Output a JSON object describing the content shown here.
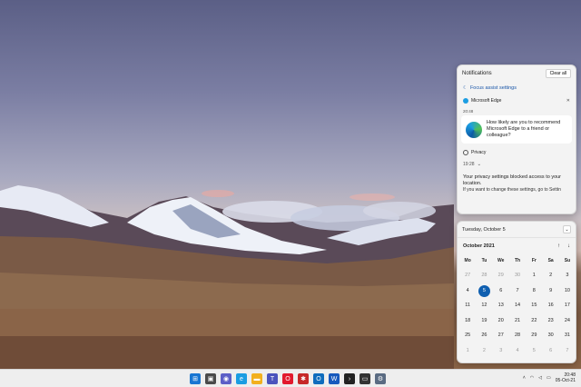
{
  "notifications": {
    "title": "Notifications",
    "clear_all": "Clear all",
    "focus_assist": "Focus assist settings",
    "edge": {
      "app_name": "Microsoft Edge",
      "time": "20:48",
      "message": "How likely are you to recommend Microsoft Edge to a friend or colleague?"
    },
    "privacy": {
      "app_name": "Privacy",
      "time": "19:28",
      "message": "Your privacy settings blocked access to your location.",
      "sub": "If you want to change these settings, go to Settin"
    }
  },
  "calendar": {
    "date_header": "Tuesday, October 5",
    "month": "October 2021",
    "prev_label": "↑",
    "next_label": "↓",
    "collapse_label": "⌄",
    "weekdays": [
      "Mo",
      "Tu",
      "We",
      "Th",
      "Fr",
      "Sa",
      "Su"
    ],
    "days": [
      {
        "d": "27",
        "m": true
      },
      {
        "d": "28",
        "m": true
      },
      {
        "d": "29",
        "m": true
      },
      {
        "d": "30",
        "m": true
      },
      {
        "d": "1"
      },
      {
        "d": "2"
      },
      {
        "d": "3"
      },
      {
        "d": "4"
      },
      {
        "d": "5",
        "today": true
      },
      {
        "d": "6"
      },
      {
        "d": "7"
      },
      {
        "d": "8"
      },
      {
        "d": "9"
      },
      {
        "d": "10"
      },
      {
        "d": "11"
      },
      {
        "d": "12"
      },
      {
        "d": "13"
      },
      {
        "d": "14"
      },
      {
        "d": "15"
      },
      {
        "d": "16"
      },
      {
        "d": "17"
      },
      {
        "d": "18"
      },
      {
        "d": "19"
      },
      {
        "d": "20"
      },
      {
        "d": "21"
      },
      {
        "d": "22"
      },
      {
        "d": "23"
      },
      {
        "d": "24"
      },
      {
        "d": "25"
      },
      {
        "d": "26"
      },
      {
        "d": "27"
      },
      {
        "d": "28"
      },
      {
        "d": "29"
      },
      {
        "d": "30"
      },
      {
        "d": "31"
      },
      {
        "d": "1",
        "m": true
      },
      {
        "d": "2",
        "m": true
      },
      {
        "d": "3",
        "m": true
      },
      {
        "d": "4",
        "m": true
      },
      {
        "d": "5",
        "m": true
      },
      {
        "d": "6",
        "m": true
      },
      {
        "d": "7",
        "m": true
      }
    ]
  },
  "taskbar": {
    "apps": [
      {
        "name": "start-icon",
        "color": "#1976d2",
        "glyph": "⊞"
      },
      {
        "name": "task-view-icon",
        "color": "#4a4a4a",
        "glyph": "▣"
      },
      {
        "name": "chat-icon",
        "color": "#5b5fc7",
        "glyph": "◉"
      },
      {
        "name": "edge-icon",
        "color": "#1b9de2",
        "glyph": "e"
      },
      {
        "name": "file-explorer-icon",
        "color": "#f2b01e",
        "glyph": "▬"
      },
      {
        "name": "teams-icon",
        "color": "#4b53bc",
        "glyph": "T"
      },
      {
        "name": "opera-icon",
        "color": "#e21a2e",
        "glyph": "O"
      },
      {
        "name": "app-icon",
        "color": "#c62828",
        "glyph": "✱"
      },
      {
        "name": "outlook-icon",
        "color": "#0f6cbd",
        "glyph": "O"
      },
      {
        "name": "word-icon",
        "color": "#185abd",
        "glyph": "W"
      },
      {
        "name": "terminal-icon",
        "color": "#222222",
        "glyph": "›"
      },
      {
        "name": "cmd-icon",
        "color": "#333333",
        "glyph": "▭"
      },
      {
        "name": "settings-icon",
        "color": "#5a6b82",
        "glyph": "⚙"
      }
    ],
    "time": "20:48",
    "date": "05-Oct-21"
  },
  "colors": {
    "accent": "#0f5fb0"
  }
}
